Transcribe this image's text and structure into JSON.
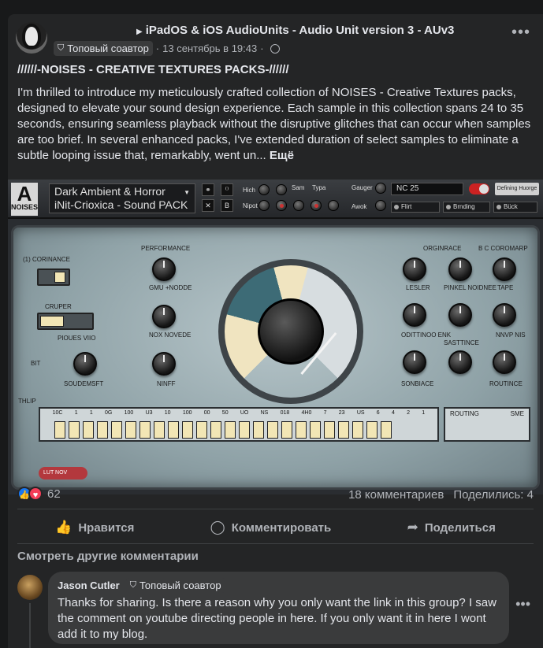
{
  "post": {
    "group_title": "iPadOS & iOS AudioUnits - Audio Unit version 3 - AUv3",
    "badge_label": "Топовый соавтор",
    "date": "13 сентябрь в 19:43",
    "title": "//////-NOISES - CREATIVE TEXTURES PACKS-//////",
    "body": "I'm thrilled to introduce my meticulously crafted collection of NOISES - Creative Textures packs, designed to elevate your sound design experience. Each sample in this collection spans 24 to 35 seconds, ensuring seamless playback without the disruptive glitches that can occur when samples are too brief. In several enhanced packs, I've extended duration of select samples to eliminate a subtle looping issue that, remarkably, went un...",
    "see_more": "Ещё"
  },
  "plugin": {
    "logo_text": "NOISES",
    "preset_line1": "Dark Ambient & Horror",
    "preset_line2": "iNit-Crioxica - Sound PACK",
    "nc_value": "NC    25",
    "db_button": "Defining Huorge",
    "top_labels": [
      "Hich",
      "Nipot",
      "Sam",
      "Typa",
      "Gauger",
      "Awok"
    ],
    "dropdowns": [
      "Flirt",
      "Brnding",
      "Bück"
    ],
    "panel_labels": {
      "coinmance": "(1) CORINANCE",
      "cruper": "CRUPER",
      "pioues": "PIOUES VIIO",
      "bit": "BIT",
      "soudemsft": "SOUDEMSFT",
      "performance": "PERFORMANCE",
      "gmu": "GMU +NODDE",
      "nox": "NOX NOVEDE",
      "ninff": "NINFF",
      "origrance": "ORGINRACE",
      "bccoromarp": "B C COROMARP",
      "lesler": "LESLER",
      "pinnell": "PINKEL NOIDNEE",
      "tape": "TAPE",
      "odittinoo": "ODITTINOO ENK",
      "sastince": "SASTTINCE",
      "nnvp": "NNVP NIS",
      "sonbiace": "SONBIACE",
      "routince": "ROUTINCE",
      "thlip": "THLIP",
      "routing": "ROUTING",
      "sme": "SME",
      "lutnov": "LUT NOV"
    },
    "strip_labels": [
      "10C",
      "1",
      "1",
      "0G",
      "100",
      "U3",
      "10",
      "100",
      "00",
      "50",
      "UO",
      "NS",
      "018",
      "4H0",
      "7",
      "23",
      "US",
      "6",
      "4",
      "2",
      "1"
    ]
  },
  "reactions": {
    "count": "62",
    "comments": "18 комментариев",
    "shares": "Поделились: 4"
  },
  "actions": {
    "like": "Нравится",
    "comment": "Комментировать",
    "share": "Поделиться"
  },
  "comments": {
    "see_more": "Смотреть другие комментарии",
    "items": [
      {
        "author": "Jason Cutler",
        "badge": "Топовый соавтор",
        "text": "Thanks for sharing. Is there a reason why you only want the link in this group? I saw the comment on youtube directing people in here. If you only want it in here I wont add it to my blog."
      }
    ]
  },
  "colors": {
    "background": "#18191a",
    "card": "#242526",
    "like_blue": "#1877f2",
    "love_red": "#f33e58"
  }
}
